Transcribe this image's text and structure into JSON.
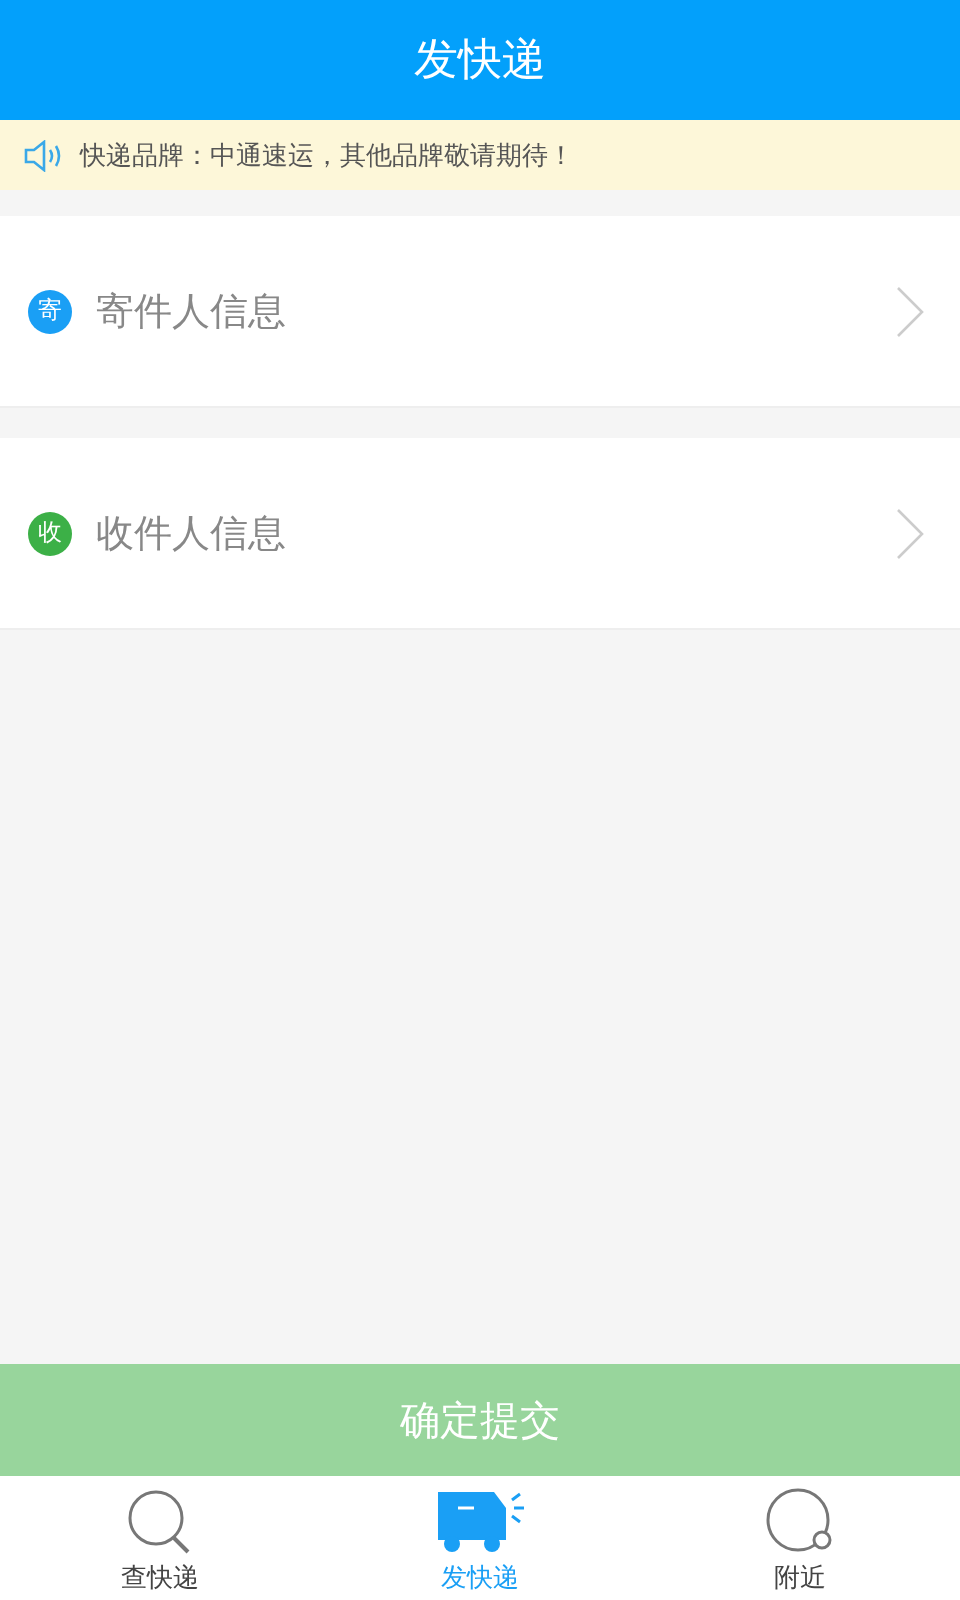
{
  "header": {
    "title": "发快递"
  },
  "notice": {
    "text": "快递品牌：中通速运，其他品牌敬请期待！"
  },
  "rows": [
    {
      "badge": "寄",
      "label": "寄件人信息",
      "color": "#1a9ff5"
    },
    {
      "badge": "收",
      "label": "收件人信息",
      "color": "#3cb047"
    }
  ],
  "submit": {
    "label": "确定提交"
  },
  "tabs": [
    {
      "kind": "search",
      "label": "查快递",
      "selected": false
    },
    {
      "kind": "truck",
      "label": "发快递",
      "selected": true
    },
    {
      "kind": "nearby",
      "label": "附近",
      "selected": false
    }
  ]
}
